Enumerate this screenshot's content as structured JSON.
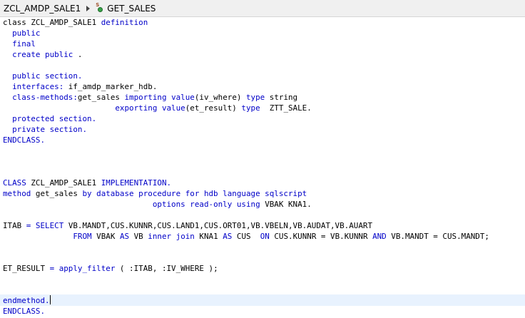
{
  "breadcrumb": {
    "class_name": "ZCL_AMDP_SALE1",
    "method_name": "GET_SALES"
  },
  "code": {
    "l1": {
      "a": "class ZCL_AMDP_SALE1 ",
      "b": "definition"
    },
    "l2": {
      "a": "public"
    },
    "l3": {
      "a": "final"
    },
    "l4": {
      "a": "create public",
      "b": " ."
    },
    "l6": {
      "a": "public section."
    },
    "l7": {
      "a": "interfaces:",
      "b": " if_amdp_marker_hdb."
    },
    "l8": {
      "a": "class-methods:",
      "b": "get_sales ",
      "c": "importing value",
      "d": "(iv_where) ",
      "e": "type",
      "f": " string"
    },
    "l9": {
      "a": "exporting value",
      "b": "(et_result) ",
      "c": "type",
      "d": "  ZTT_SALE."
    },
    "l10": {
      "a": "protected section."
    },
    "l11": {
      "a": "private section."
    },
    "l12": {
      "a": "ENDCLASS."
    },
    "l16": {
      "a": "CLASS",
      "b": " ZCL_AMDP_SALE1 ",
      "c": "IMPLEMENTATION."
    },
    "l17": {
      "a": "method",
      "b": " get_sales ",
      "c": "by database procedure for hdb language sqlscript"
    },
    "l18": {
      "a": "options read-only using",
      "b": " VBAK KNA1."
    },
    "l20": {
      "a": "ITAB ",
      "b": "= SELECT",
      "c": " VB.MANDT,CUS.KUNNR,CUS.LAND1,CUS.ORT01,VB.VBELN,VB.AUDAT,VB.AUART"
    },
    "l21": {
      "a": "FROM",
      "b": " VBAK ",
      "c": "AS",
      "d": " VB ",
      "e": "inner join",
      "f": " KNA1 ",
      "g": "AS",
      "h": " CUS  ",
      "i": "ON",
      "j": " CUS.KUNNR = VB.KUNNR ",
      "k": "AND",
      "l": " VB.MANDT = CUS.MANDT;"
    },
    "l24": {
      "a": "ET_RESULT ",
      "b": "= apply_filter",
      "c": " ( :ITAB, :IV_WHERE );"
    },
    "l27": {
      "a": "endmethod."
    },
    "l28": {
      "a": "ENDCLASS."
    }
  },
  "colors": {
    "keyword": "#0000c8",
    "text": "#000000",
    "current_line": "#e8f2fe",
    "breadcrumb_bg": "#f0f0f0"
  },
  "icons": {
    "separator": "chevron-right-icon",
    "method": "method-icon"
  }
}
